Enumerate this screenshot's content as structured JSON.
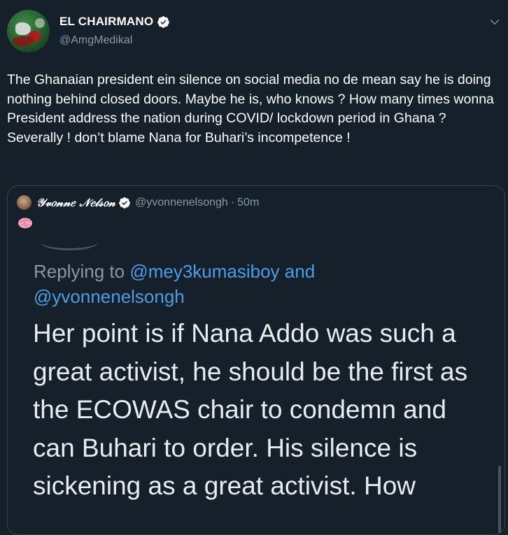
{
  "author": {
    "display_name": "EL CHAIRMANO",
    "handle": "@AmgMedikal",
    "verified": true
  },
  "tweet": {
    "text": "The Ghanaian president ein silence on social media no de mean say he is doing nothing behind closed doors. Maybe he is, who knows ? How many times wonna President address the nation during COVID/ lockdown period in Ghana ? Severally ! don’t blame Nana for Buhari’s incompetence !"
  },
  "quoted_tweet": {
    "display_name": "𝒴𝓋𝑜𝓃𝓃𝑒 𝒩𝑒𝓁𝓈𝑜𝓃",
    "handle": "@yvonnenelsongh",
    "separator": "·",
    "time": "50m",
    "emoji": "🧠",
    "screenshot": {
      "replying_prefix": "Replying to ",
      "replying_user1": "@mey3kumasiboy",
      "replying_and": " and",
      "replying_user2": "@yvonnenelsongh",
      "text": "Her point is if Nana Addo was such a great activist, he should be the first as the ECOWAS chair to condemn and can Buhari to order. His silence is sickening as a great activist. How"
    }
  },
  "icons": {
    "verified": "verified-badge-icon",
    "caret": "chevron-down-icon",
    "brain": "brain-emoji-icon"
  },
  "colors": {
    "background": "#15202b",
    "secondary_text": "#8899a6",
    "link": "#4b9ee6",
    "border": "#38444d"
  }
}
